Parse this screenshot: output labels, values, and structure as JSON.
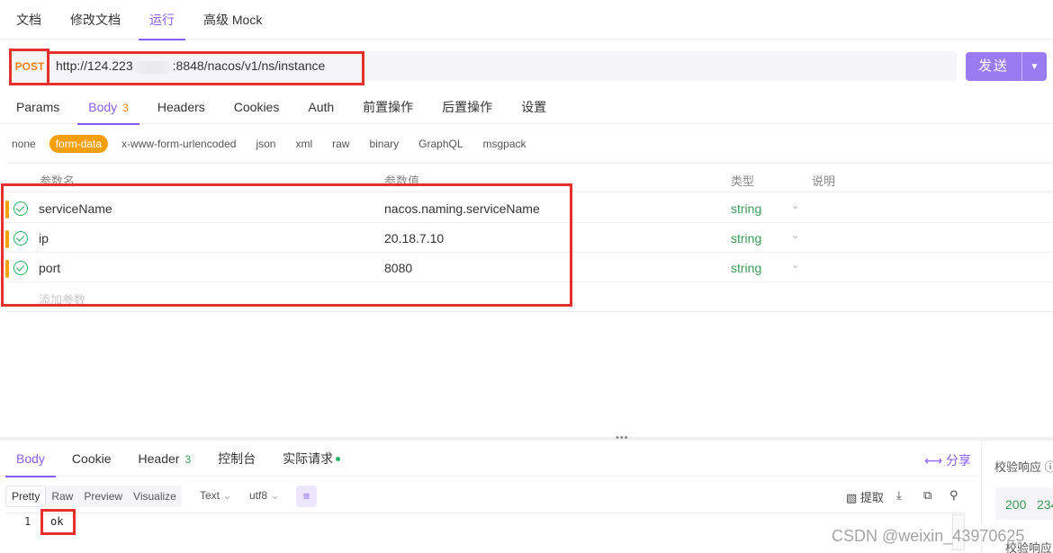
{
  "top_tabs": [
    "文档",
    "修改文档",
    "运行",
    "高级 Mock"
  ],
  "request": {
    "method": "POST",
    "url_prefix": "http://124.223",
    "url_suffix": ":8848/nacos/v1/ns/instance",
    "send_label": "发送"
  },
  "request_tabs": {
    "params": "Params",
    "body": "Body",
    "body_count": "3",
    "headers": "Headers",
    "cookies": "Cookies",
    "auth": "Auth",
    "pre": "前置操作",
    "post": "后置操作",
    "settings": "设置"
  },
  "body_types": [
    "none",
    "form-data",
    "x-www-form-urlencoded",
    "json",
    "xml",
    "raw",
    "binary",
    "GraphQL",
    "msgpack"
  ],
  "param_table": {
    "headers": {
      "name": "参数名",
      "value": "参数值",
      "type": "类型",
      "desc": "说明"
    },
    "rows": [
      {
        "name": "serviceName",
        "value": "nacos.naming.serviceName",
        "type": "string"
      },
      {
        "name": "ip",
        "value": "20.18.7.10",
        "type": "string"
      },
      {
        "name": "port",
        "value": "8080",
        "type": "string"
      }
    ],
    "add_placeholder": "添加参数"
  },
  "response_tabs": {
    "body": "Body",
    "cookie": "Cookie",
    "header": "Header",
    "header_count": "3",
    "console": "控制台",
    "actual": "实际请求"
  },
  "share_label": "分享",
  "view_modes": [
    "Pretty",
    "Raw",
    "Preview",
    "Visualize"
  ],
  "format_select": "Text",
  "encoding_select": "utf8",
  "extract_label": "提取",
  "code": {
    "line": "1",
    "text": "ok"
  },
  "right_panel": {
    "validate_label": "校验响应",
    "status": "200",
    "time": "234"
  },
  "watermark": "CSDN @weixin_43970625",
  "colors": {
    "accent": "#8b5cf6",
    "method": "#f2811d",
    "highlight": "#e5302e",
    "type": "#3a9a56"
  }
}
